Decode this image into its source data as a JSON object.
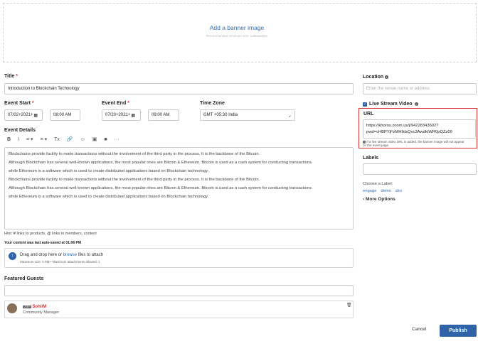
{
  "banner": {
    "title": "Add a banner image",
    "subtitle": "Recommended minimum size: 1280x200px"
  },
  "title_field": {
    "label": "Title",
    "value": "Introduction to Blockchain Technology"
  },
  "event_start": {
    "label": "Event Start",
    "date": "07/02+2021+",
    "time": "08:00 AM"
  },
  "event_end": {
    "label": "Event End",
    "date": "07/20+2021+",
    "time": "09:00 AM"
  },
  "timezone": {
    "label": "Time Zone",
    "value": "GMT +05:30 India"
  },
  "details": {
    "label": "Event Details",
    "toolbar": [
      "B",
      "I",
      "≡",
      "≡",
      "Tx",
      "🔗",
      "☺",
      "▣",
      "■",
      "···"
    ],
    "lines": [
      "Blockchains provide facility to make transactions without the involvement of the third party in the process. It is the backbone of the Bitcoin.",
      "Although Blockchain has several well-known applications, the most popular ones are Bitcoin & Ethereum. Bitcoin is used as a cash system for conducting transactions",
      "while Ethereum is a software which is used to create distributed applications based on Blockchain technology.",
      "Blockchains provide facility to make transactions without the involvement of the third party in the process. It is the backbone of the Bitcoin.",
      "Although Blockchain has several well-known applications, the most popular ones are Bitcoin & Ethereum. Bitcoin is used as a cash system for conducting transactions",
      "while Ethereum is a software which is used to create distributed applications based on Blockchain technology."
    ]
  },
  "hint": {
    "prefix": "Hint:",
    "hash": "#",
    "products": "links to products,",
    "at": "@",
    "members": "links to members, content"
  },
  "autosave": "Your content was last auto-saved at 01:06 PM",
  "attach": {
    "text_before": "Drag and drop here or ",
    "browse": "browse",
    "text_after": " files to attach",
    "sub": "Maximum size: 5 MB • Maximum attachments allowed: 1"
  },
  "guests": {
    "label": "Featured Guests",
    "person": {
      "badge": "USER",
      "name": "SohilM",
      "role": "Community Manager"
    }
  },
  "location": {
    "label": "Location",
    "placeholder": "Enter the venue name or address"
  },
  "live_stream": {
    "label": "Live Stream Video"
  },
  "url": {
    "label": "URL",
    "line1": "https://khoros.zoom.us/j/94228343602?",
    "line2": "pwd=cHBPYjFzMHlldzQvc3AwdktWR0pQZz09",
    "note1": "If a live stream video URL is added, the banner image will not appear",
    "note2": "on the event page."
  },
  "labels": {
    "label": "Labels",
    "choose": "Choose a Label:",
    "tags": [
      "engage",
      "demo",
      "sko"
    ],
    "more": "More Options"
  },
  "actions": {
    "cancel": "Cancel",
    "publish": "Publish"
  },
  "colors": {
    "accent": "#2f62a6",
    "highlight": "#d43333",
    "link": "#2e6ab3"
  }
}
